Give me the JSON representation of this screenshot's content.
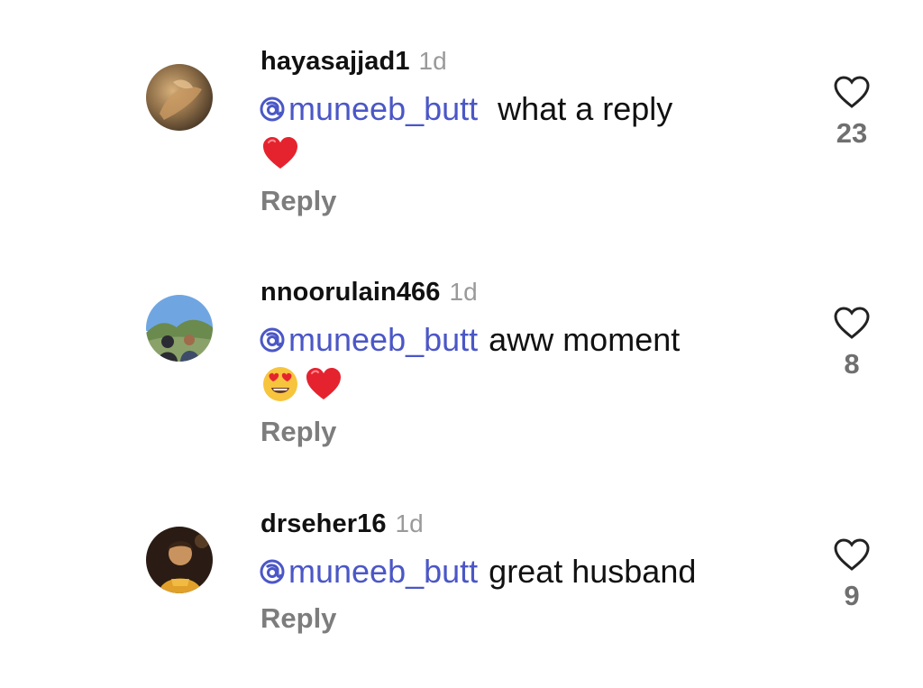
{
  "comments": [
    {
      "username": "hayasajjad1",
      "time": "1d",
      "mention": "muneeb_butt",
      "text": "what a reply",
      "emojis": [
        "red-heart"
      ],
      "reply_label": "Reply",
      "likes": "23"
    },
    {
      "username": "nnoorulain466",
      "time": "1d",
      "mention": "muneeb_butt",
      "text": "aww moment",
      "emojis": [
        "heart-eyes",
        "red-heart"
      ],
      "reply_label": "Reply",
      "likes": "8"
    },
    {
      "username": "drseher16",
      "time": "1d",
      "mention": "muneeb_butt",
      "text": "great husband",
      "emojis": [],
      "reply_label": "Reply",
      "likes": "9"
    }
  ],
  "colors": {
    "mention": "#4b57c6",
    "secondary_text": "#7d7d7d",
    "emoji_heart": "#e5232f",
    "emoji_face": "#f7c43d"
  }
}
